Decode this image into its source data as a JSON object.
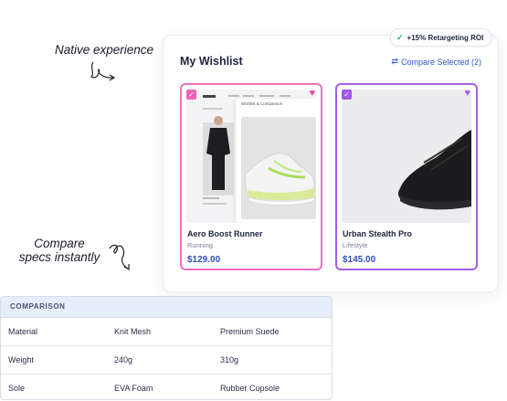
{
  "annotations": {
    "native": "Native experience",
    "compare_line1": "Compare",
    "compare_line2": "specs instantly"
  },
  "badge": {
    "label": "+15% Retargeting ROI",
    "icon": "check-icon"
  },
  "wishlist": {
    "title": "My Wishlist",
    "compare_label": "Compare Selected (2)",
    "compare_icon": "compare-arrows-icon",
    "mock_overlay_title": "Wishlist & Comparison",
    "products": [
      {
        "name": "Aero Boost Runner",
        "category": "Running",
        "price": "$129.00",
        "accent": "#f06fbd"
      },
      {
        "name": "Urban Stealth Pro",
        "category": "Lifestyle",
        "price": "$145.00",
        "accent": "#a75ee6"
      }
    ]
  },
  "comparison": {
    "header": "COMPARISON",
    "rows": [
      [
        "Material",
        "Knit Mesh",
        "Premium Suede"
      ],
      [
        "Weight",
        "240g",
        "310g"
      ],
      [
        "Sole",
        "EVA Foam",
        "Rubber Cupsole"
      ]
    ]
  },
  "colors": {
    "accent_blue": "#2d59c9",
    "pink": "#f06fbd",
    "purple": "#a75ee6",
    "success": "#1fb56b"
  }
}
